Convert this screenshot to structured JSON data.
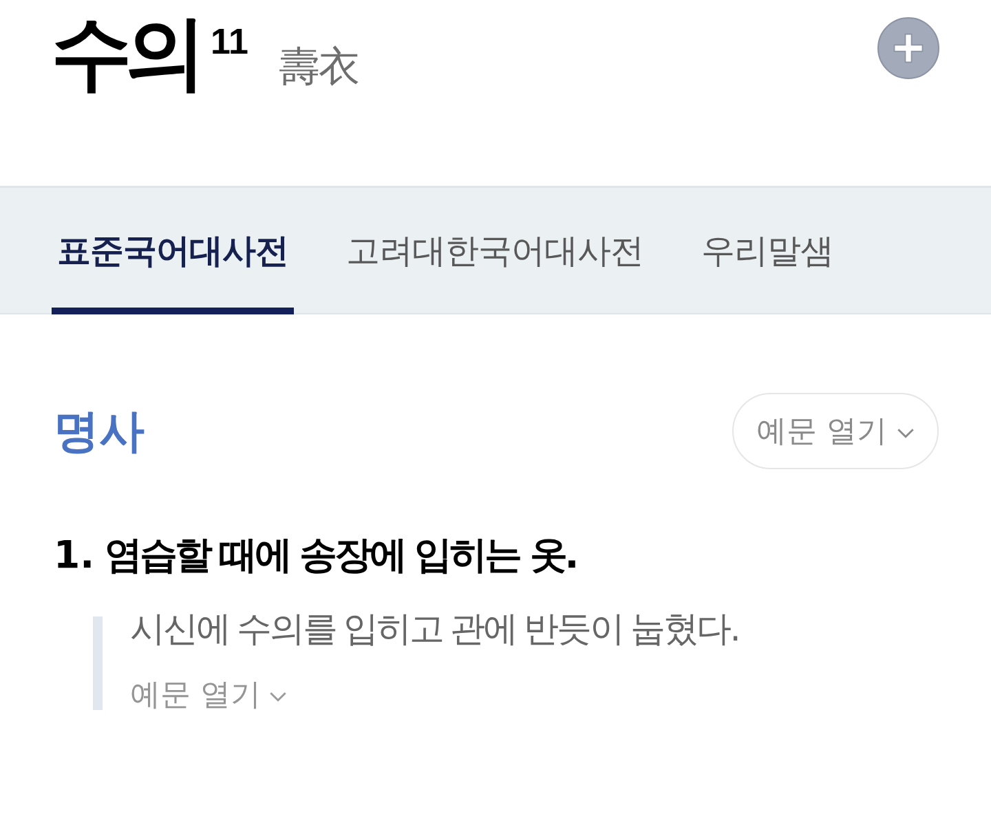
{
  "entry": {
    "headword": "수의",
    "homonym_number": "11",
    "hanja": "壽衣"
  },
  "tabs": [
    {
      "label": "표준국어대사전",
      "selected": true
    },
    {
      "label": "고려대한국어대사전",
      "selected": false
    },
    {
      "label": "우리말샘",
      "selected": false
    }
  ],
  "sense_group": {
    "part_of_speech": "명사",
    "toggle_label": "예문 열기"
  },
  "definitions": [
    {
      "number": "1.",
      "text": "염습할 때에 송장에 입히는 옷.",
      "examples": [
        "시신에 수의를 입히고 관에 반듯이 눕혔다."
      ],
      "toggle_label": "예문 열기"
    }
  ]
}
